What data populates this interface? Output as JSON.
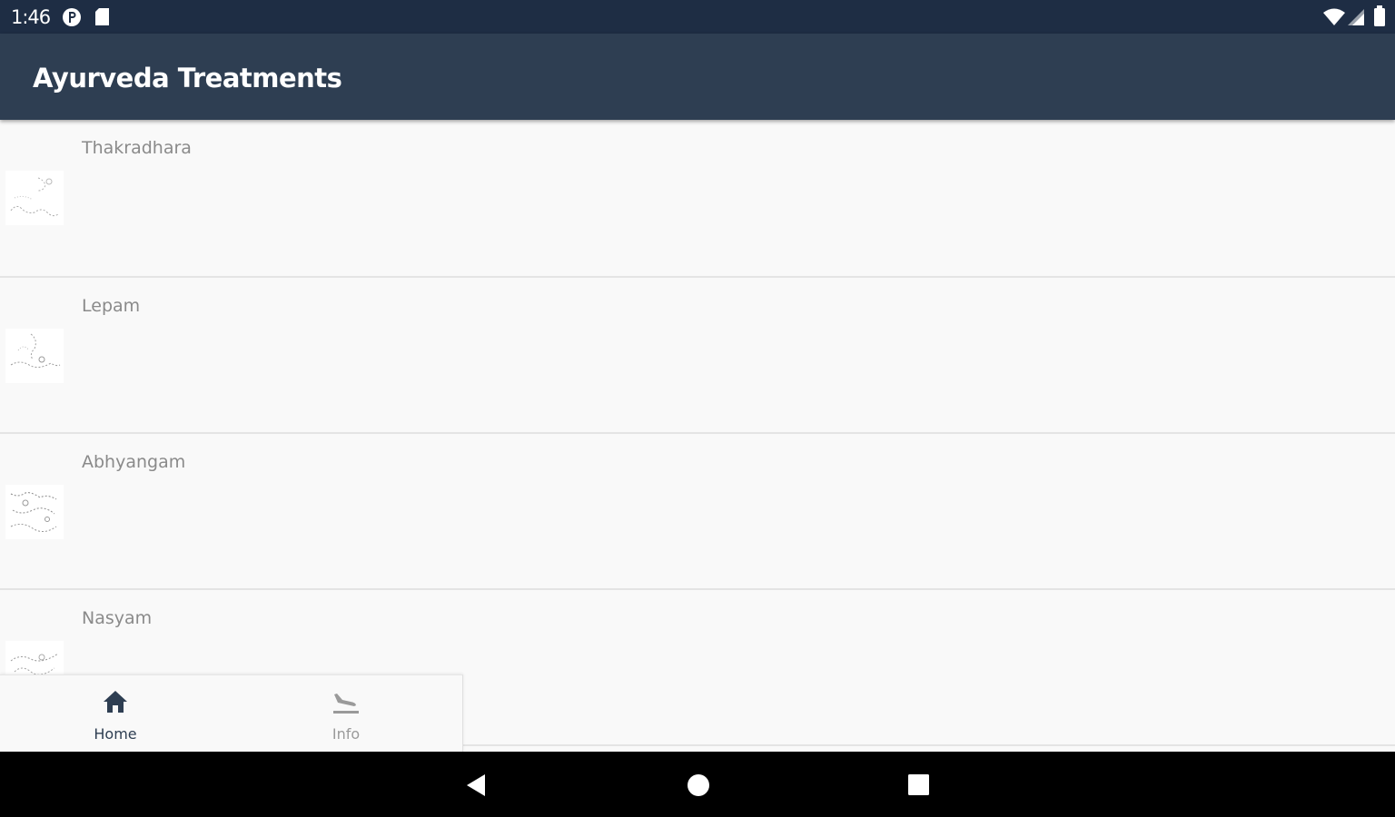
{
  "status_bar": {
    "time": "1:46",
    "icons": [
      "p-circle-icon",
      "sd-card-icon",
      "wifi-icon",
      "cell-signal-icon",
      "battery-icon"
    ]
  },
  "app_bar": {
    "title": "Ayurveda Treatments"
  },
  "treatments": [
    {
      "name": "Thakradhara",
      "thumb_icon": "treatment-illustration"
    },
    {
      "name": "Lepam",
      "thumb_icon": "treatment-illustration"
    },
    {
      "name": "Abhyangam",
      "thumb_icon": "treatment-illustration"
    },
    {
      "name": "Nasyam",
      "thumb_icon": "treatment-illustration"
    }
  ],
  "bottom_nav": {
    "home_label": "Home",
    "info_label": "Info",
    "active": "home"
  },
  "colors": {
    "status_bar": "#1e2d44",
    "app_bar": "#2e3e52",
    "active_nav": "#2e3e52",
    "inactive_nav": "#9a9a9a",
    "list_title": "#8a8a8a"
  },
  "system_nav": {
    "back": "back-icon",
    "home": "home-circle-icon",
    "recents": "recents-square-icon"
  }
}
